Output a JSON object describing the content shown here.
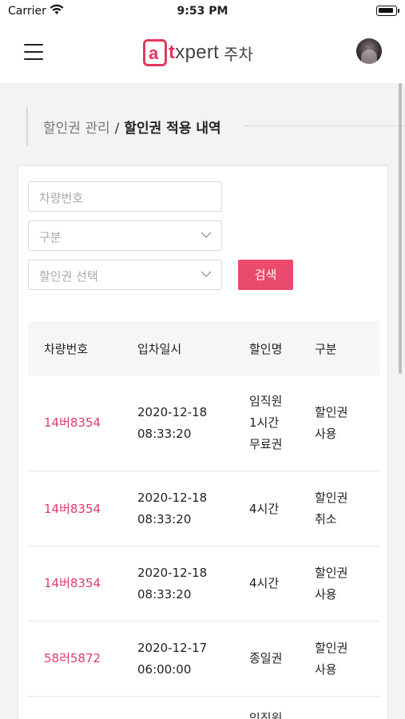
{
  "status_bar": {
    "carrier": "Carrier",
    "time": "9:53 PM"
  },
  "header": {
    "logo_mark": "a",
    "logo_brand_t": "t",
    "logo_brand_rest": "xpert",
    "logo_suffix": "주차"
  },
  "breadcrumb": {
    "parent": "할인권 관리",
    "separator": "/",
    "current": "할인권 적용 내역"
  },
  "filters": {
    "plate_placeholder": "차량번호",
    "type_placeholder": "구분",
    "discount_placeholder": "할인권 선택",
    "search_label": "검색"
  },
  "table": {
    "headers": [
      "차량번호",
      "입차일시",
      "할인명",
      "구분"
    ],
    "rows": [
      {
        "plate": "14버8354",
        "date": "2020-12-18",
        "time": "08:33:20",
        "name": [
          "임직원",
          "1시간",
          "무료권"
        ],
        "type": [
          "할인권",
          "사용"
        ]
      },
      {
        "plate": "14버8354",
        "date": "2020-12-18",
        "time": "08:33:20",
        "name": [
          "4시간"
        ],
        "type": [
          "할인권",
          "취소"
        ]
      },
      {
        "plate": "14버8354",
        "date": "2020-12-18",
        "time": "08:33:20",
        "name": [
          "4시간"
        ],
        "type": [
          "할인권",
          "사용"
        ]
      },
      {
        "plate": "58러5872",
        "date": "2020-12-17",
        "time": "06:00:00",
        "name": [
          "종일권"
        ],
        "type": [
          "할인권",
          "사용"
        ]
      },
      {
        "plate": "",
        "date": "",
        "time": "",
        "name": [
          "임직원"
        ],
        "type": []
      }
    ]
  },
  "colors": {
    "accent": "#ea4a6b",
    "plate_text": "#e03a6b"
  }
}
